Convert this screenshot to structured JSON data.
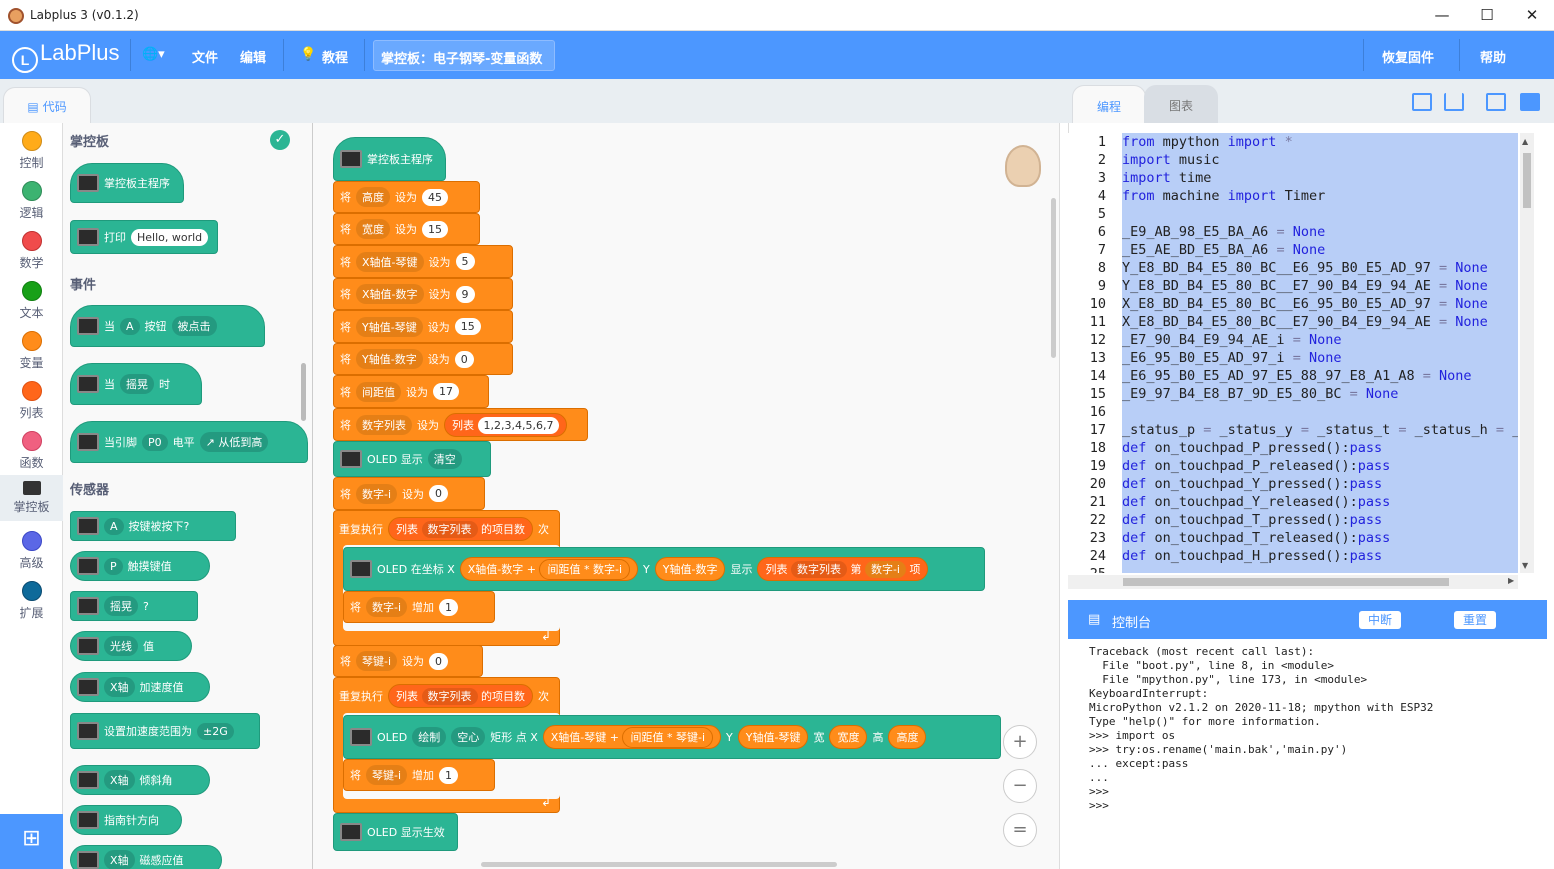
{
  "window": {
    "title": "Labplus 3 (v0.1.2)",
    "minimize": "—",
    "maximize": "☐",
    "close": "✕"
  },
  "menu": {
    "logo": "LabPlus",
    "globe": "🌐▾",
    "file": "文件",
    "edit": "编辑",
    "tutorial": "教程",
    "project": "掌控板：电子钢琴-变量函数",
    "restore": "恢复固件",
    "help": "帮助"
  },
  "tabs": {
    "code": "代码",
    "program": "编程",
    "chart": "图表"
  },
  "categories": [
    {
      "label": "控制",
      "color": "#ffab19"
    },
    {
      "label": "逻辑",
      "color": "#3cb371"
    },
    {
      "label": "数学",
      "color": "#f04b4b"
    },
    {
      "label": "文本",
      "color": "#18a018"
    },
    {
      "label": "变量",
      "color": "#ff8c1a"
    },
    {
      "label": "列表",
      "color": "#ff661a"
    },
    {
      "label": "函数",
      "color": "#f06080"
    },
    {
      "label": "掌控板",
      "color": "#555555"
    },
    {
      "label": "高级",
      "color": "#5b67e6"
    },
    {
      "label": "扩展",
      "color": "#0e6a9a"
    }
  ],
  "flyout": {
    "h_board": "掌控板",
    "main_prog": "掌控板主程序",
    "print": "打印",
    "hello": "Hello, world",
    "h_events": "事件",
    "when": "当",
    "btn_a": "A",
    "button": "按钮",
    "pressed": "被点击",
    "shake": "摇晃",
    "when_t": "时",
    "pin_when": "当引脚",
    "p0": "P0",
    "level": "电平",
    "low_high": "↗ 从低到高",
    "h_sensors": "传感器",
    "a": "A",
    "btn_pressed": "按键被按下?",
    "p": "P",
    "touch": "触摸键值",
    "shake2": "摇晃",
    "q": "?",
    "light": "光线",
    "value": "值",
    "x_axis": "X轴",
    "accel": "加速度值",
    "set_accel": "设置加速度范围为",
    "g2": "±2G",
    "x_axis2": "X轴",
    "tilt": "倾斜角",
    "compass": "指南针方向",
    "x_axis3": "X轴",
    "mag": "磁感应值"
  },
  "script": {
    "main": "掌控板主程序",
    "set": "将",
    "to": "设为",
    "v_height": "高度",
    "n45": "45",
    "v_width": "宽度",
    "n15": "15",
    "v_xkey": "X轴值-琴键",
    "n5": "5",
    "v_xnum": "X轴值-数字",
    "n9": "9",
    "v_ykey": "Y轴值-琴键",
    "n15b": "15",
    "v_ynum": "Y轴值-数字",
    "n0": "0",
    "v_gap": "间距值",
    "n17": "17",
    "v_list": "数字列表",
    "list": "列表",
    "list_val": "1,2,3,4,5,6,7",
    "oled_show": "OLED 显示",
    "clear": "清空",
    "v_numi": "数字-i",
    "n0b": "0",
    "repeat": "重复执行",
    "list2": "列表",
    "list_name": "数字列表",
    "item_count": "的项目数",
    "times": "次",
    "oled_at": "OLED 在坐标 X",
    "xnum": "X轴值-数字",
    "plus": "+",
    "gap": "间距值",
    "mul": "*",
    "numi": "数字-i",
    "y": "Y",
    "ynum": "Y轴值-数字",
    "show": "显示",
    "list3": "列表",
    "list_name2": "数字列表",
    "nth": "第",
    "numi2": "数字-i",
    "item": "项",
    "v_numi2": "数字-i",
    "inc": "增加",
    "n1": "1",
    "v_keyi": "琴键-i",
    "n0c": "0",
    "repeat2": "重复执行",
    "list4": "列表",
    "list_name3": "数字列表",
    "item_count2": "的项目数",
    "times2": "次",
    "oled": "OLED",
    "draw": "绘制",
    "hollow": "空心",
    "rect": "矩形 点 X",
    "xkey": "X轴值-琴键",
    "plus2": "+",
    "gap2": "间距值",
    "mul2": "*",
    "keyi": "琴键-i",
    "y2": "Y",
    "ykey": "Y轴值-琴键",
    "w": "宽",
    "width": "宽度",
    "h": "高",
    "height": "高度",
    "v_keyi2": "琴键-i",
    "inc2": "增加",
    "n1b": "1",
    "oled_apply": "OLED 显示生效"
  },
  "zoom": {
    "in": "+",
    "out": "−",
    "reset": "="
  },
  "code_lines": [
    {
      "n": "1",
      "t": "from mpython import *"
    },
    {
      "n": "2",
      "t": "import music"
    },
    {
      "n": "3",
      "t": "import time"
    },
    {
      "n": "4",
      "t": "from machine import Timer"
    },
    {
      "n": "5",
      "t": ""
    },
    {
      "n": "6",
      "t": "_E9_AB_98_E5_BA_A6 = None"
    },
    {
      "n": "7",
      "t": "_E5_AE_BD_E5_BA_A6 = None"
    },
    {
      "n": "8",
      "t": "Y_E8_BD_B4_E5_80_BC__E6_95_B0_E5_AD_97 = None"
    },
    {
      "n": "9",
      "t": "Y_E8_BD_B4_E5_80_BC__E7_90_B4_E9_94_AE = None"
    },
    {
      "n": "10",
      "t": "X_E8_BD_B4_E5_80_BC__E6_95_B0_E5_AD_97 = None"
    },
    {
      "n": "11",
      "t": "X_E8_BD_B4_E5_80_BC__E7_90_B4_E9_94_AE = None"
    },
    {
      "n": "12",
      "t": "_E7_90_B4_E9_94_AE_i = None"
    },
    {
      "n": "13",
      "t": "_E6_95_B0_E5_AD_97_i = None"
    },
    {
      "n": "14",
      "t": "_E6_95_B0_E5_AD_97_E5_88_97_E8_A1_A8 = None"
    },
    {
      "n": "15",
      "t": "_E9_97_B4_E8_B7_9D_E5_80_BC = None"
    },
    {
      "n": "16",
      "t": ""
    },
    {
      "n": "17",
      "t": "_status_p = _status_y = _status_t = _status_h = _"
    },
    {
      "n": "18",
      "t": "def on_touchpad_P_pressed():pass"
    },
    {
      "n": "19",
      "t": "def on_touchpad_P_released():pass"
    },
    {
      "n": "20",
      "t": "def on_touchpad_Y_pressed():pass"
    },
    {
      "n": "21",
      "t": "def on_touchpad_Y_released():pass"
    },
    {
      "n": "22",
      "t": "def on_touchpad_T_pressed():pass"
    },
    {
      "n": "23",
      "t": "def on_touchpad_T_released():pass"
    },
    {
      "n": "24",
      "t": "def on_touchpad_H_pressed():pass"
    },
    {
      "n": "25",
      "t": ""
    }
  ],
  "console": {
    "title": "控制台",
    "interrupt": "中断",
    "reset": "重置",
    "output": "Traceback (most recent call last):\n  File \"boot.py\", line 8, in <module>\n  File \"mpython.py\", line 173, in <module>\nKeyboardInterrupt:\nMicroPython v2.1.2 on 2020-11-18; mpython with ESP32\nType \"help()\" for more information.\n>>> import os\n>>> try:os.rename('main.bak','main.py')\n... except:pass\n...\n>>>\n>>>"
  }
}
